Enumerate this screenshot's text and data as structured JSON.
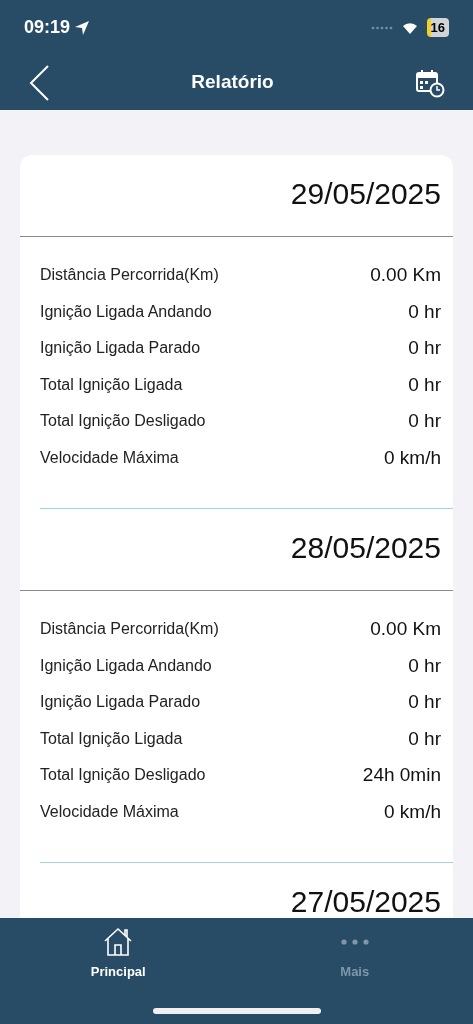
{
  "status_bar": {
    "time": "09:19",
    "battery": "16"
  },
  "nav": {
    "title": "Relatório"
  },
  "reports": [
    {
      "date": "29/05/2025",
      "rows": [
        {
          "label": "Distância Percorrida(Km)",
          "value": "0.00 Km"
        },
        {
          "label": "Ignição Ligada Andando",
          "value": "0 hr"
        },
        {
          "label": "Ignição Ligada Parado",
          "value": "0 hr"
        },
        {
          "label": "Total Ignição Ligada",
          "value": "0 hr"
        },
        {
          "label": "Total Ignição Desligado",
          "value": "0 hr"
        },
        {
          "label": "Velocidade Máxima",
          "value": "0 km/h"
        }
      ]
    },
    {
      "date": "28/05/2025",
      "rows": [
        {
          "label": "Distância Percorrida(Km)",
          "value": "0.00 Km"
        },
        {
          "label": "Ignição Ligada Andando",
          "value": "0 hr"
        },
        {
          "label": "Ignição Ligada Parado",
          "value": "0 hr"
        },
        {
          "label": "Total Ignição Ligada",
          "value": "0 hr"
        },
        {
          "label": "Total Ignição Desligado",
          "value": "24h 0min"
        },
        {
          "label": "Velocidade Máxima",
          "value": "0 km/h"
        }
      ]
    },
    {
      "date": "27/05/2025"
    }
  ],
  "tabs": [
    {
      "label": "Principal",
      "kind": "home",
      "selected": true
    },
    {
      "label": "Mais",
      "kind": "more",
      "selected": false
    }
  ]
}
